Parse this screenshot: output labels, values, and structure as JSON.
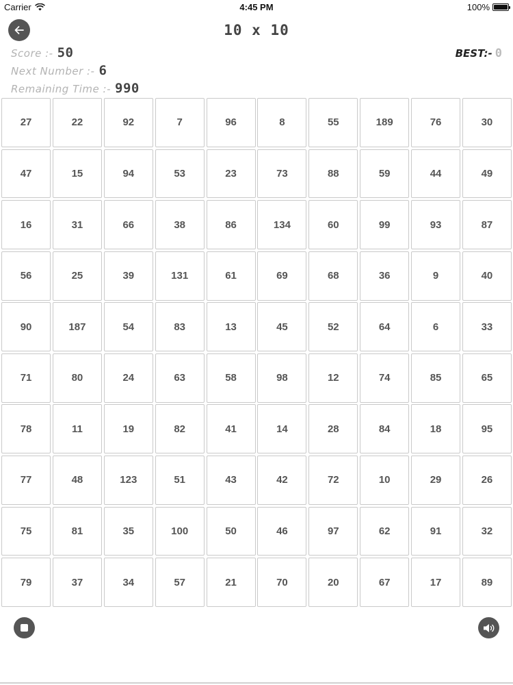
{
  "status_bar": {
    "carrier": "Carrier",
    "time": "4:45 PM",
    "battery": "100%"
  },
  "header": {
    "title": "10 x 10",
    "back_icon": "arrow-left-icon"
  },
  "stats": {
    "score_label": "Score :-",
    "score_value": "50",
    "next_label": "Next Number :-",
    "next_value": "6",
    "time_label": "Remaining Time :-",
    "time_value": "990",
    "best_label": "BEST:-",
    "best_value": "0"
  },
  "grid": {
    "rows": 10,
    "cols": 10,
    "cells": [
      27,
      22,
      92,
      7,
      96,
      8,
      55,
      189,
      76,
      30,
      47,
      15,
      94,
      53,
      23,
      73,
      88,
      59,
      44,
      49,
      16,
      31,
      66,
      38,
      86,
      134,
      60,
      99,
      93,
      87,
      56,
      25,
      39,
      131,
      61,
      69,
      68,
      36,
      9,
      40,
      90,
      187,
      54,
      83,
      13,
      45,
      52,
      64,
      6,
      33,
      71,
      80,
      24,
      63,
      58,
      98,
      12,
      74,
      85,
      65,
      78,
      11,
      19,
      82,
      41,
      14,
      28,
      84,
      18,
      95,
      77,
      48,
      123,
      51,
      43,
      42,
      72,
      10,
      29,
      26,
      75,
      81,
      35,
      100,
      50,
      46,
      97,
      62,
      91,
      32,
      79,
      37,
      34,
      57,
      21,
      70,
      20,
      67,
      17,
      89
    ]
  },
  "controls": {
    "stop_icon": "stop-icon",
    "sound_icon": "speaker-icon"
  },
  "colors": {
    "button_bg": "#555555",
    "cell_border": "#c9c9c9",
    "label_gray": "#b3b3b3"
  }
}
